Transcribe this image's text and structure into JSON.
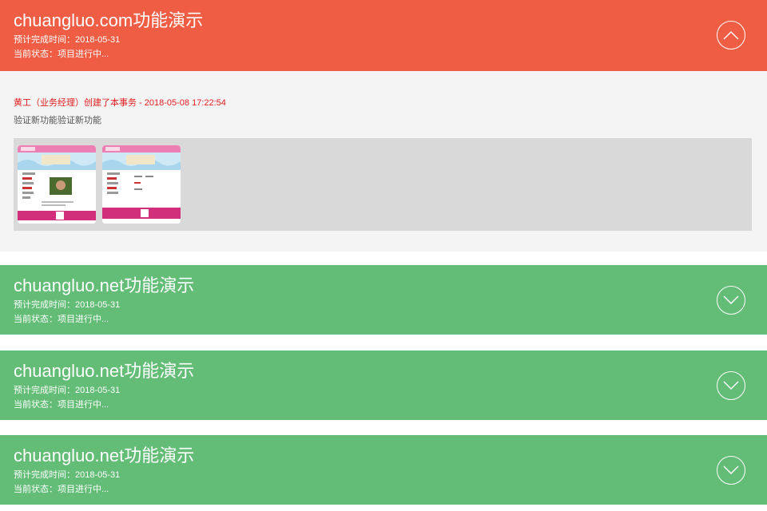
{
  "tasks": [
    {
      "title": "chuangluo.com功能演示",
      "due": "预计完成时间：2018-05-31",
      "status": "当前状态：项目进行中...",
      "expanded": true,
      "color": "#ef5d44"
    },
    {
      "title": "chuangluo.net功能演示",
      "due": "预计完成时间：2018-05-31",
      "status": "当前状态：项目进行中...",
      "expanded": false,
      "color": "#63bd77"
    },
    {
      "title": "chuangluo.net功能演示",
      "due": "预计完成时间：2018-05-31",
      "status": "当前状态：项目进行中...",
      "expanded": false,
      "color": "#63bd77"
    },
    {
      "title": "chuangluo.net功能演示",
      "due": "预计完成时间：2018-05-31",
      "status": "当前状态：项目进行中...",
      "expanded": false,
      "color": "#63bd77"
    }
  ],
  "detail": {
    "log": "黄工（业务经理）创建了本事务 - 2018-05-08 17:22:54",
    "description": "验证新功能验证新功能",
    "log_color": "#e02020"
  },
  "icons": {
    "collapse": "chevron-up-icon",
    "expand": "chevron-down-icon"
  }
}
